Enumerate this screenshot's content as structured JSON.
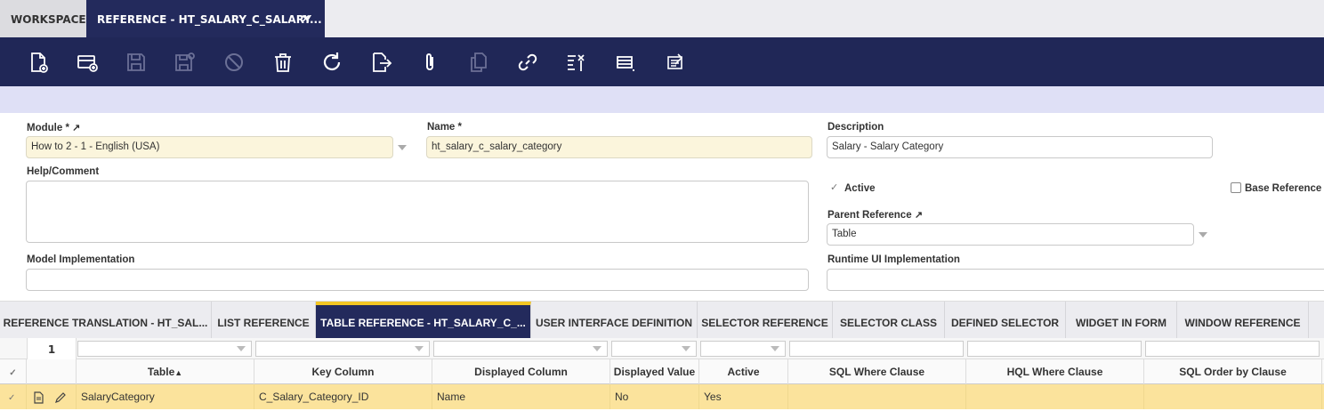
{
  "top_tabs": {
    "workspace": "WORKSPACE",
    "active": "REFERENCE - HT_SALARY_C_SALARY...",
    "close": "×"
  },
  "toolbar": {
    "icons": [
      "new-document-icon",
      "new-row-icon",
      "save-icon",
      "save-close-icon",
      "undo-icon",
      "delete-icon",
      "refresh-icon",
      "export-icon",
      "attachment-icon",
      "clone-icon",
      "link-icon",
      "tools-icon",
      "grid-view-icon",
      "audit-icon"
    ]
  },
  "form": {
    "module_label": "Module *",
    "module_value": "How to 2 - 1 - English (USA)",
    "name_label": "Name *",
    "name_value": "ht_salary_c_salary_category",
    "description_label": "Description",
    "description_value": "Salary - Salary Category",
    "help_label": "Help/Comment",
    "active_label": "Active",
    "active_checked": true,
    "base_reference_label": "Base Reference",
    "base_reference_checked": false,
    "parent_label": "Parent Reference",
    "parent_value": "Table",
    "model_impl_label": "Model Implementation",
    "runtime_ui_label": "Runtime UI Implementation"
  },
  "sub_tabs": [
    "REFERENCE TRANSLATION - HT_SAL...",
    "LIST REFERENCE",
    "TABLE REFERENCE - HT_SALARY_C_...",
    "USER INTERFACE DEFINITION",
    "SELECTOR REFERENCE",
    "SELECTOR CLASS",
    "DEFINED SELECTOR",
    "WIDGET IN FORM",
    "WINDOW REFERENCE"
  ],
  "grid": {
    "row_count": "1",
    "columns": [
      "Table",
      "Key Column",
      "Displayed Column",
      "Displayed Value",
      "Active",
      "SQL Where Clause",
      "HQL Where Clause",
      "SQL Order by Clause"
    ],
    "sort_indicator": "▲",
    "rows": [
      [
        "SalaryCategory",
        "C_Salary_Category_ID",
        "Name",
        "No",
        "Yes",
        "",
        "",
        ""
      ]
    ]
  },
  "colors": {
    "navy": "#202757",
    "active_tab": "#232a5c",
    "accent_yellow": "#f3c623",
    "required_field": "#fbf5dc",
    "selected_row": "#fbe39c"
  }
}
